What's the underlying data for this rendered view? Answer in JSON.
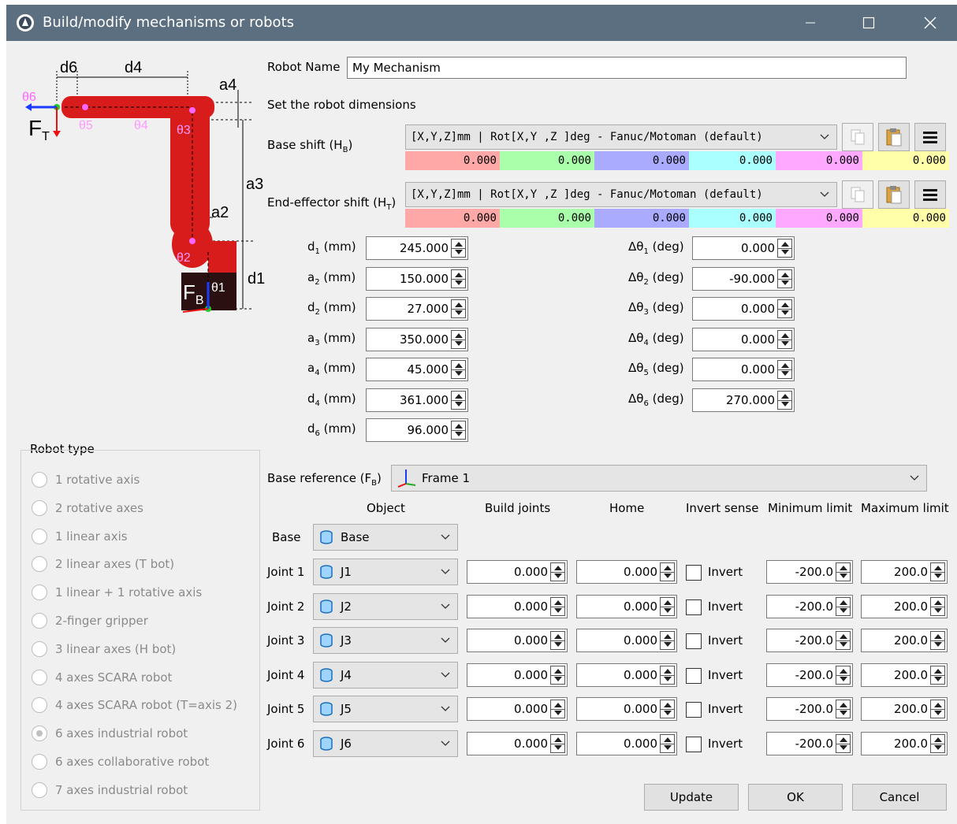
{
  "window": {
    "title": "Build/modify mechanisms or robots"
  },
  "diagram": {
    "labels": {
      "d6": "d6",
      "d4": "d4",
      "a4": "a4",
      "a3": "a3",
      "a2": "a2",
      "d1": "d1",
      "theta6": "θ6",
      "theta5": "θ5",
      "theta4": "θ4",
      "theta3": "θ3",
      "theta2": "θ2",
      "theta1": "θ1",
      "ft": "F",
      "ft_sub": "T",
      "fb": "F",
      "fb_sub": "B"
    },
    "colors": {
      "arm": "#d81b1b",
      "joint": "#ff66ff",
      "base": "#2a1010"
    }
  },
  "form": {
    "robot_name_label": "Robot Name",
    "robot_name_value": "My Mechanism",
    "dimensions_label": "Set the robot dimensions",
    "base_shift_label": "Base shift (H",
    "base_shift_sub": "B",
    "ee_shift_label": "End-effector shift (H",
    "ee_shift_sub": "T",
    "shift_format": "[X,Y,Z]mm | Rot[X,Y ,Z  ]deg - Fanuc/Motoman (default)",
    "base_shift_values": [
      "0.000",
      "0.000",
      "0.000",
      "0.000",
      "0.000",
      "0.000"
    ],
    "ee_shift_values": [
      "0.000",
      "0.000",
      "0.000",
      "0.000",
      "0.000",
      "0.000"
    ],
    "shift_colors": [
      "#ffa8a8",
      "#aaffaa",
      "#aaaaff",
      "#aaffff",
      "#ffa8ff",
      "#ffffaa"
    ]
  },
  "dims": [
    {
      "name": "d",
      "sub": "1",
      "unit": " (mm)",
      "value": "245.000"
    },
    {
      "name": "a",
      "sub": "2",
      "unit": " (mm)",
      "value": "150.000"
    },
    {
      "name": "d",
      "sub": "2",
      "unit": " (mm)",
      "value": "27.000"
    },
    {
      "name": "a",
      "sub": "3",
      "unit": " (mm)",
      "value": "350.000"
    },
    {
      "name": "a",
      "sub": "4",
      "unit": " (mm)",
      "value": "45.000"
    },
    {
      "name": "d",
      "sub": "4",
      "unit": " (mm)",
      "value": "361.000"
    },
    {
      "name": "d",
      "sub": "6",
      "unit": " (mm)",
      "value": "96.000"
    }
  ],
  "thetas": [
    {
      "name": "Δθ",
      "sub": "1",
      "unit": " (deg)",
      "value": "0.000"
    },
    {
      "name": "Δθ",
      "sub": "2",
      "unit": " (deg)",
      "value": "-90.000"
    },
    {
      "name": "Δθ",
      "sub": "3",
      "unit": " (deg)",
      "value": "0.000"
    },
    {
      "name": "Δθ",
      "sub": "4",
      "unit": " (deg)",
      "value": "0.000"
    },
    {
      "name": "Δθ",
      "sub": "5",
      "unit": " (deg)",
      "value": "0.000"
    },
    {
      "name": "Δθ",
      "sub": "6",
      "unit": " (deg)",
      "value": "270.000"
    }
  ],
  "robot_type": {
    "title": "Robot type",
    "options": [
      {
        "label": "1 rotative axis",
        "checked": false
      },
      {
        "label": "2 rotative axes",
        "checked": false
      },
      {
        "label": "1 linear axis",
        "checked": false
      },
      {
        "label": "2 linear axes (T bot)",
        "checked": false
      },
      {
        "label": "1 linear + 1 rotative axis",
        "checked": false
      },
      {
        "label": "2-finger gripper",
        "checked": false
      },
      {
        "label": "3 linear axes (H bot)",
        "checked": false
      },
      {
        "label": "4 axes SCARA robot",
        "checked": false
      },
      {
        "label": "4 axes SCARA robot (T=axis 2)",
        "checked": false
      },
      {
        "label": "6 axes industrial robot",
        "checked": true
      },
      {
        "label": "6 axes collaborative robot",
        "checked": false
      },
      {
        "label": "7 axes industrial robot",
        "checked": false
      }
    ]
  },
  "base_ref": {
    "label": "Base reference (F",
    "sub": "B",
    "value": "Frame 1"
  },
  "joints_table": {
    "headers": {
      "object": "Object",
      "build": "Build joints",
      "home": "Home",
      "invert": "Invert sense",
      "min": "Minimum limit",
      "max": "Maximum limit"
    },
    "base_label": "Base",
    "base_object": "Base",
    "invert_label": "Invert",
    "rows": [
      {
        "label": "Joint 1",
        "object": "J1",
        "build": "0.000",
        "home": "0.000",
        "min": "-200.0",
        "max": "200.0"
      },
      {
        "label": "Joint 2",
        "object": "J2",
        "build": "0.000",
        "home": "0.000",
        "min": "-200.0",
        "max": "200.0"
      },
      {
        "label": "Joint 3",
        "object": "J3",
        "build": "0.000",
        "home": "0.000",
        "min": "-200.0",
        "max": "200.0"
      },
      {
        "label": "Joint 4",
        "object": "J4",
        "build": "0.000",
        "home": "0.000",
        "min": "-200.0",
        "max": "200.0"
      },
      {
        "label": "Joint 5",
        "object": "J5",
        "build": "0.000",
        "home": "0.000",
        "min": "-200.0",
        "max": "200.0"
      },
      {
        "label": "Joint 6",
        "object": "J6",
        "build": "0.000",
        "home": "0.000",
        "min": "-200.0",
        "max": "200.0"
      }
    ]
  },
  "buttons": {
    "update": "Update",
    "ok": "OK",
    "cancel": "Cancel"
  }
}
